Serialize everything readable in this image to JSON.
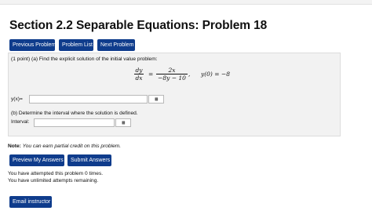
{
  "page": {
    "title": "Section 2.2 Separable Equations: Problem 18"
  },
  "nav": {
    "previous": "Previous Problem",
    "list": "Problem List",
    "next": "Next Problem"
  },
  "problem": {
    "part_a": "(1 point) (a) Find the explicit solution of the initial value problem:",
    "lhs_num": "dy",
    "lhs_den": "dx",
    "equals": "=",
    "rhs_num": "2x",
    "rhs_den": "−8y − 10",
    "comma": ",",
    "initial_condition": "y(0) = −8",
    "y_label": "y(x)=",
    "y_value": "",
    "part_b": "(b) Determine the interval where the solution is defined.",
    "interval_label": "Interval:",
    "interval_value": "",
    "palette_glyph": "▦"
  },
  "footer": {
    "note_label": "Note:",
    "note_text": "You can earn partial credit on this problem.",
    "preview_button": "Preview My Answers",
    "submit_button": "Submit Answers",
    "attempts": "You have attempted this problem 0 times.",
    "remaining": "You have unlimited attempts remaining.",
    "email_button": "Email instructor"
  },
  "colors": {
    "button_bg": "#0f3c8c",
    "panel_bg": "#f2f2f2"
  }
}
